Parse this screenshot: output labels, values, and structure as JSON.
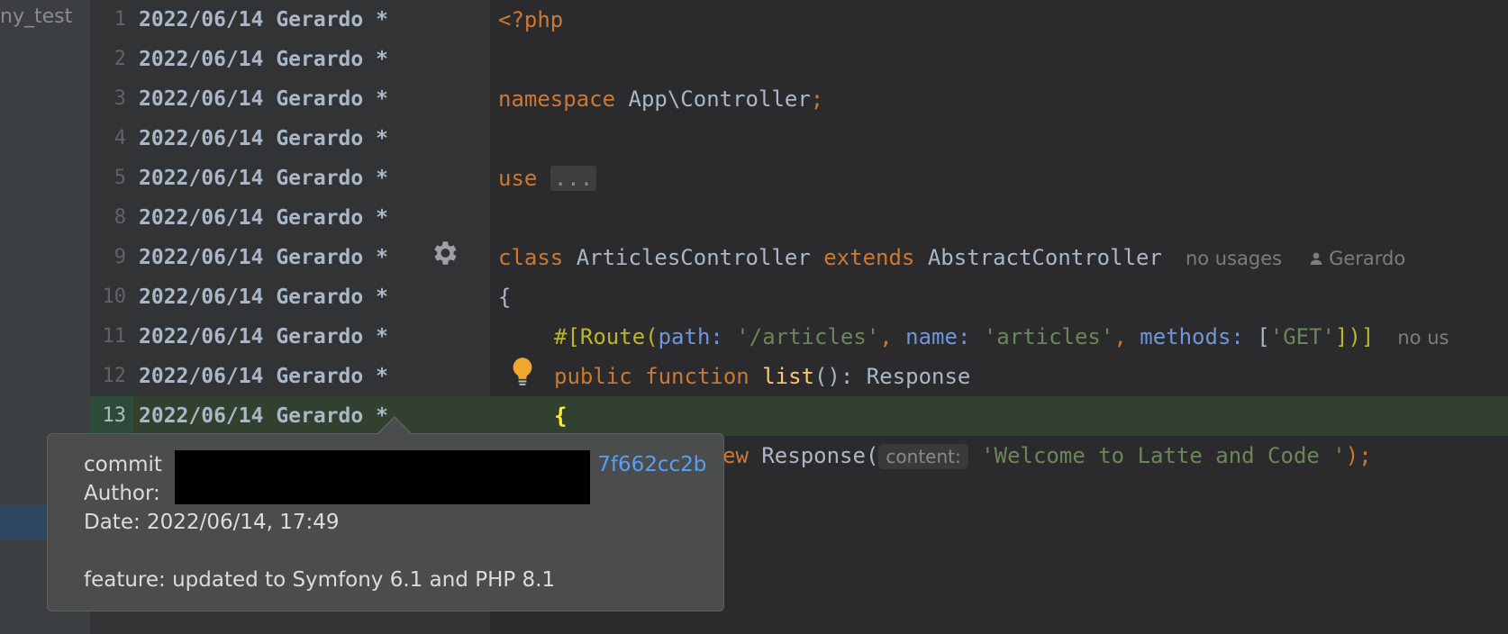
{
  "project": {
    "label": "ny_test"
  },
  "blame": {
    "rows": [
      {
        "line": "1",
        "text": "2022/06/14 Gerardo *"
      },
      {
        "line": "2",
        "text": "2022/06/14 Gerardo *"
      },
      {
        "line": "3",
        "text": "2022/06/14 Gerardo *"
      },
      {
        "line": "4",
        "text": "2022/06/14 Gerardo *"
      },
      {
        "line": "5",
        "text": "2022/06/14 Gerardo *"
      },
      {
        "line": "8",
        "text": "2022/06/14 Gerardo *"
      },
      {
        "line": "9",
        "text": "2022/06/14 Gerardo *"
      },
      {
        "line": "10",
        "text": "2022/06/14 Gerardo *"
      },
      {
        "line": "11",
        "text": "2022/06/14 Gerardo *"
      },
      {
        "line": "12",
        "text": "2022/06/14 Gerardo *"
      },
      {
        "line": "13",
        "text": "2022/06/14 Gerardo *"
      }
    ]
  },
  "code": {
    "l1": "<?php",
    "l3_kw": "namespace",
    "l3_ns": " App\\Controller",
    "l3_semi": ";",
    "l5_kw": "use",
    "l5_fold": "...",
    "l7_kw1": "class",
    "l7_name": " ArticlesController ",
    "l7_kw2": "extends",
    "l7_parent": " AbstractController",
    "l7_usages": "no usages",
    "l7_author": "Gerardo",
    "l8": "{",
    "l9_open": "#[Route(",
    "l9_p1": "path:",
    "l9_s1": " '/articles'",
    "l9_c1": ", ",
    "l9_p2": "name:",
    "l9_s2": " 'articles'",
    "l9_c2": ", ",
    "l9_p3": "methods:",
    "l9_b1": " [",
    "l9_s3": "'GET'",
    "l9_close": "])]",
    "l9_hint": "no us",
    "l10_kw": "public function ",
    "l10_fn": "list",
    "l10_rest": "(): Response",
    "l11": "{",
    "l12_kw": "ew",
    "l12_cls": " Response(",
    "l12_inlay": "content:",
    "l12_str": "'Welcome to Latte and Code '",
    "l12_end": ");"
  },
  "popup": {
    "commit_label": "commit ",
    "commit_hash_tail": "7f662cc2b",
    "author_label": "Author: ",
    "date_line": "Date: 2022/06/14, 17:49",
    "message": "feature: updated to Symfony 6.1 and PHP 8.1"
  }
}
